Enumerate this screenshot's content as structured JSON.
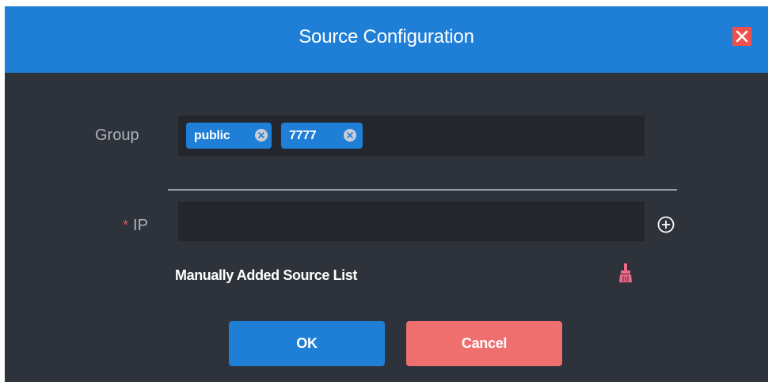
{
  "dialog": {
    "title": "Source Configuration",
    "close_icon": "close-icon"
  },
  "form": {
    "group": {
      "label": "Group",
      "tags": [
        "public",
        "7777"
      ]
    },
    "ip": {
      "required_mark": "*",
      "label": "IP",
      "value": "",
      "placeholder": "",
      "add_icon": "plus-circle-icon"
    },
    "manual_list": {
      "title": "Manually Added Source List",
      "clear_icon": "broom-icon"
    }
  },
  "buttons": {
    "ok": "OK",
    "cancel": "Cancel"
  },
  "colors": {
    "header": "#1f7fd6",
    "body": "#2e323a",
    "field": "#23262d",
    "tag": "#1f7fd6",
    "close": "#f0504d",
    "ok": "#1f7fd6",
    "cancel": "#ef6f6f",
    "required": "#e0565b",
    "clear_icon": "#f06a8a"
  }
}
